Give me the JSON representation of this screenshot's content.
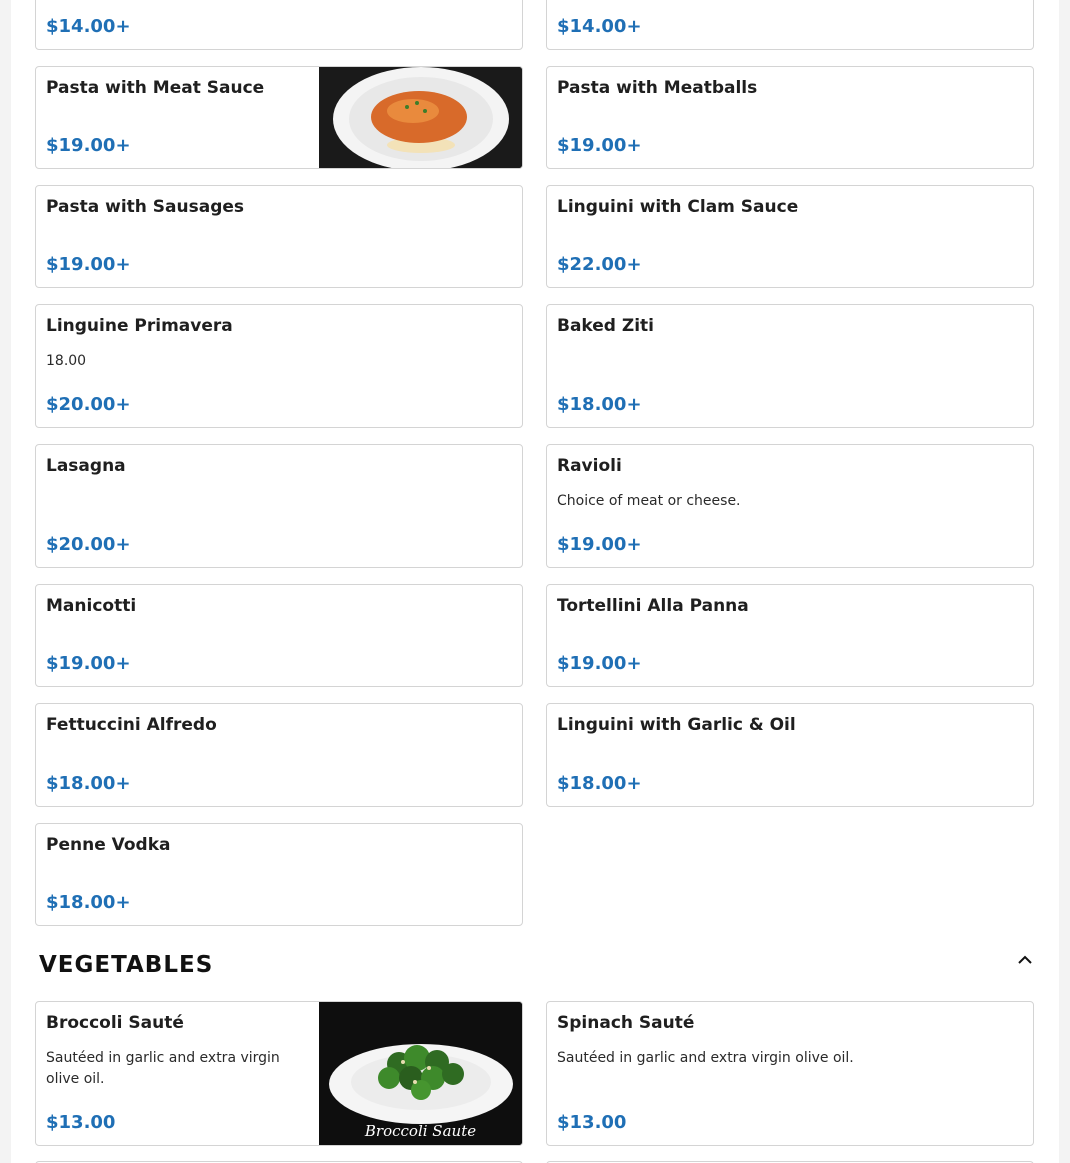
{
  "pasta_items": [
    {
      "price": "$14.00+"
    },
    {
      "price": "$14.00+"
    },
    {
      "name": "Pasta with Meat Sauce",
      "price": "$19.00+"
    },
    {
      "name": "Pasta with Meatballs",
      "price": "$19.00+"
    },
    {
      "name": "Pasta with Sausages",
      "price": "$19.00+"
    },
    {
      "name": "Linguini with Clam Sauce",
      "price": "$22.00+"
    },
    {
      "name": "Linguine Primavera",
      "description": "18.00",
      "price": "$20.00+"
    },
    {
      "name": "Baked Ziti",
      "price": "$18.00+"
    },
    {
      "name": "Lasagna",
      "price": "$20.00+"
    },
    {
      "name": "Ravioli",
      "description": "Choice of meat or cheese.",
      "price": "$19.00+"
    },
    {
      "name": "Manicotti",
      "price": "$19.00+"
    },
    {
      "name": "Tortellini Alla Panna",
      "price": "$19.00+"
    },
    {
      "name": "Fettuccini Alfredo",
      "price": "$18.00+"
    },
    {
      "name": "Linguini with Garlic & Oil",
      "price": "$18.00+"
    },
    {
      "name": "Penne Vodka",
      "price": "$18.00+"
    }
  ],
  "vegetables": {
    "title": "VEGETABLES",
    "toggle_icon": "chevron-up-icon",
    "items": [
      {
        "name": "Broccoli Sauté",
        "description": "Sautéed in garlic and extra virgin olive oil.",
        "price": "$13.00",
        "photo_caption": "Broccoli Saute"
      },
      {
        "name": "Spinach Sauté",
        "description": "Sautéed in garlic and extra virgin olive oil.",
        "price": "$13.00"
      }
    ]
  },
  "colors": {
    "price": "#1f6fb5",
    "border": "#d4d4d4"
  }
}
